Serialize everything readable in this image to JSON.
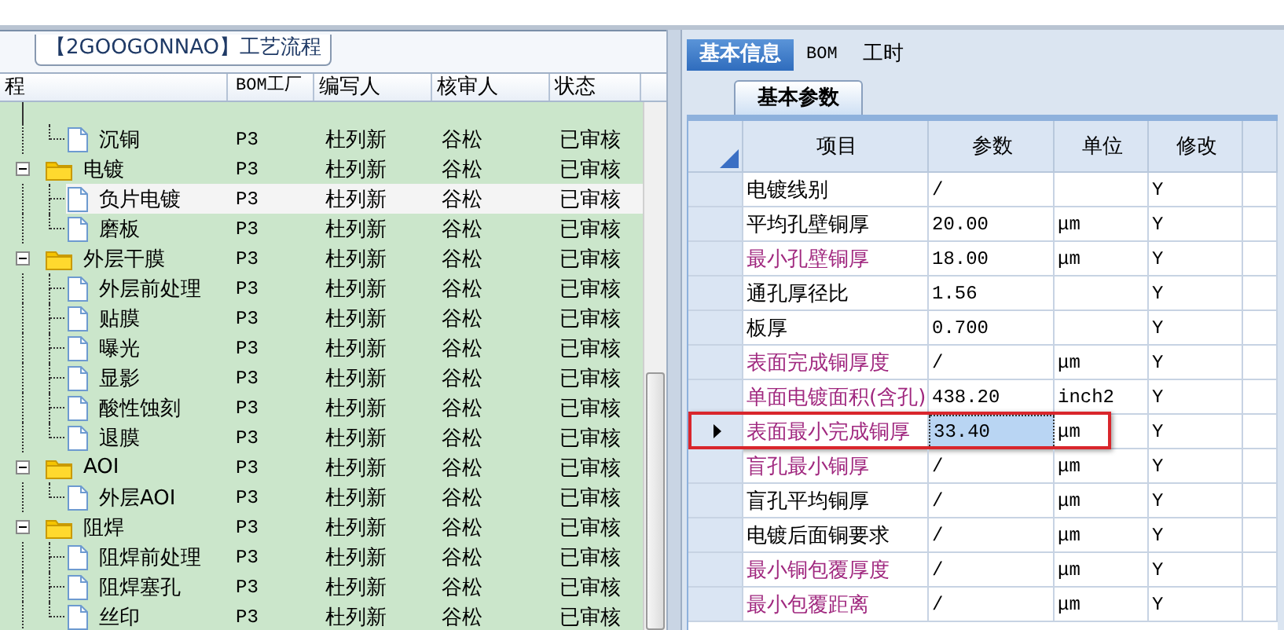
{
  "left_panel": {
    "title": "【2GOOGONNAO】工艺流程",
    "columns": [
      "程",
      "BOM工厂",
      "编写人",
      "核审人",
      "状态"
    ],
    "orphan_children": [
      {
        "label": "沉铜",
        "kind": "leaf",
        "bom": "P3",
        "author": "杜列新",
        "reviewer": "谷松",
        "status": "已审核",
        "selected": false
      }
    ],
    "tree": [
      {
        "label": "电镀",
        "kind": "folder",
        "expanded": true,
        "bom": "P3",
        "author": "杜列新",
        "reviewer": "谷松",
        "status": "已审核",
        "selected": false,
        "children": [
          {
            "label": "负片电镀",
            "kind": "leaf",
            "bom": "P3",
            "author": "杜列新",
            "reviewer": "谷松",
            "status": "已审核",
            "selected": true
          },
          {
            "label": "磨板",
            "kind": "leaf",
            "bom": "P3",
            "author": "杜列新",
            "reviewer": "谷松",
            "status": "已审核",
            "selected": false
          }
        ]
      },
      {
        "label": "外层干膜",
        "kind": "folder",
        "expanded": true,
        "bom": "P3",
        "author": "杜列新",
        "reviewer": "谷松",
        "status": "已审核",
        "selected": false,
        "children": [
          {
            "label": "外层前处理",
            "kind": "leaf",
            "bom": "P3",
            "author": "杜列新",
            "reviewer": "谷松",
            "status": "已审核",
            "selected": false
          },
          {
            "label": "贴膜",
            "kind": "leaf",
            "bom": "P3",
            "author": "杜列新",
            "reviewer": "谷松",
            "status": "已审核",
            "selected": false
          },
          {
            "label": "曝光",
            "kind": "leaf",
            "bom": "P3",
            "author": "杜列新",
            "reviewer": "谷松",
            "status": "已审核",
            "selected": false
          },
          {
            "label": "显影",
            "kind": "leaf",
            "bom": "P3",
            "author": "杜列新",
            "reviewer": "谷松",
            "status": "已审核",
            "selected": false
          },
          {
            "label": "酸性蚀刻",
            "kind": "leaf",
            "bom": "P3",
            "author": "杜列新",
            "reviewer": "谷松",
            "status": "已审核",
            "selected": false
          },
          {
            "label": "退膜",
            "kind": "leaf",
            "bom": "P3",
            "author": "杜列新",
            "reviewer": "谷松",
            "status": "已审核",
            "selected": false
          }
        ]
      },
      {
        "label": "AOI",
        "kind": "folder",
        "expanded": true,
        "bom": "P3",
        "author": "杜列新",
        "reviewer": "谷松",
        "status": "已审核",
        "selected": false,
        "children": [
          {
            "label": "外层AOI",
            "kind": "leaf",
            "bom": "P3",
            "author": "杜列新",
            "reviewer": "谷松",
            "status": "已审核",
            "selected": false
          }
        ]
      },
      {
        "label": "阻焊",
        "kind": "folder",
        "expanded": true,
        "bom": "P3",
        "author": "杜列新",
        "reviewer": "谷松",
        "status": "已审核",
        "selected": false,
        "children": [
          {
            "label": "阻焊前处理",
            "kind": "leaf",
            "bom": "P3",
            "author": "杜列新",
            "reviewer": "谷松",
            "status": "已审核",
            "selected": false
          },
          {
            "label": "阻焊塞孔",
            "kind": "leaf",
            "bom": "P3",
            "author": "杜列新",
            "reviewer": "谷松",
            "status": "已审核",
            "selected": false
          },
          {
            "label": "丝印",
            "kind": "leaf",
            "bom": "P3",
            "author": "杜列新",
            "reviewer": "谷松",
            "status": "已审核",
            "selected": false
          }
        ]
      }
    ]
  },
  "right_panel": {
    "tabs": [
      {
        "label": "基本信息",
        "selected": true
      },
      {
        "label": "BOM",
        "selected": false
      },
      {
        "label": "工时",
        "selected": false
      }
    ],
    "sub_tabs": [
      {
        "label": "基本参数",
        "selected": true
      }
    ],
    "grid": {
      "columns": [
        "项目",
        "参数",
        "单位",
        "修改"
      ],
      "rows": [
        {
          "item": "电镀线别",
          "color": "#000000",
          "value": "/",
          "unit": "",
          "modify": "Y",
          "current": false,
          "highlighted": false
        },
        {
          "item": "平均孔壁铜厚",
          "color": "#000000",
          "value": "20.00",
          "unit": "μm",
          "modify": "Y",
          "current": false,
          "highlighted": false
        },
        {
          "item": "最小孔壁铜厚",
          "color": "#a0287f",
          "value": "18.00",
          "unit": "μm",
          "modify": "Y",
          "current": false,
          "highlighted": false
        },
        {
          "item": "通孔厚径比",
          "color": "#000000",
          "value": "1.56",
          "unit": "",
          "modify": "Y",
          "current": false,
          "highlighted": false
        },
        {
          "item": "板厚",
          "color": "#000000",
          "value": "0.700",
          "unit": "",
          "modify": "Y",
          "current": false,
          "highlighted": false
        },
        {
          "item": "表面完成铜厚度",
          "color": "#a0287f",
          "value": "/",
          "unit": "μm",
          "modify": "Y",
          "current": false,
          "highlighted": false
        },
        {
          "item": "单面电镀面积(含孔)",
          "color": "#a0287f",
          "value": "438.20",
          "unit": "inch2",
          "modify": "Y",
          "current": false,
          "highlighted": false
        },
        {
          "item": "表面最小完成铜厚",
          "color": "#a0287f",
          "value": "33.40",
          "unit": "μm",
          "modify": "Y",
          "current": true,
          "highlighted": true
        },
        {
          "item": "盲孔最小铜厚",
          "color": "#a0287f",
          "value": "/",
          "unit": "μm",
          "modify": "Y",
          "current": false,
          "highlighted": false
        },
        {
          "item": "盲孔平均铜厚",
          "color": "#000000",
          "value": "/",
          "unit": "μm",
          "modify": "Y",
          "current": false,
          "highlighted": false
        },
        {
          "item": "电镀后面铜要求",
          "color": "#000000",
          "value": "/",
          "unit": "μm",
          "modify": "Y",
          "current": false,
          "highlighted": false
        },
        {
          "item": "最小铜包覆厚度",
          "color": "#a0287f",
          "value": "/",
          "unit": "μm",
          "modify": "Y",
          "current": false,
          "highlighted": false
        },
        {
          "item": "最小包覆距离",
          "color": "#a0287f",
          "value": "/",
          "unit": "μm",
          "modify": "Y",
          "current": false,
          "highlighted": false
        }
      ]
    }
  }
}
